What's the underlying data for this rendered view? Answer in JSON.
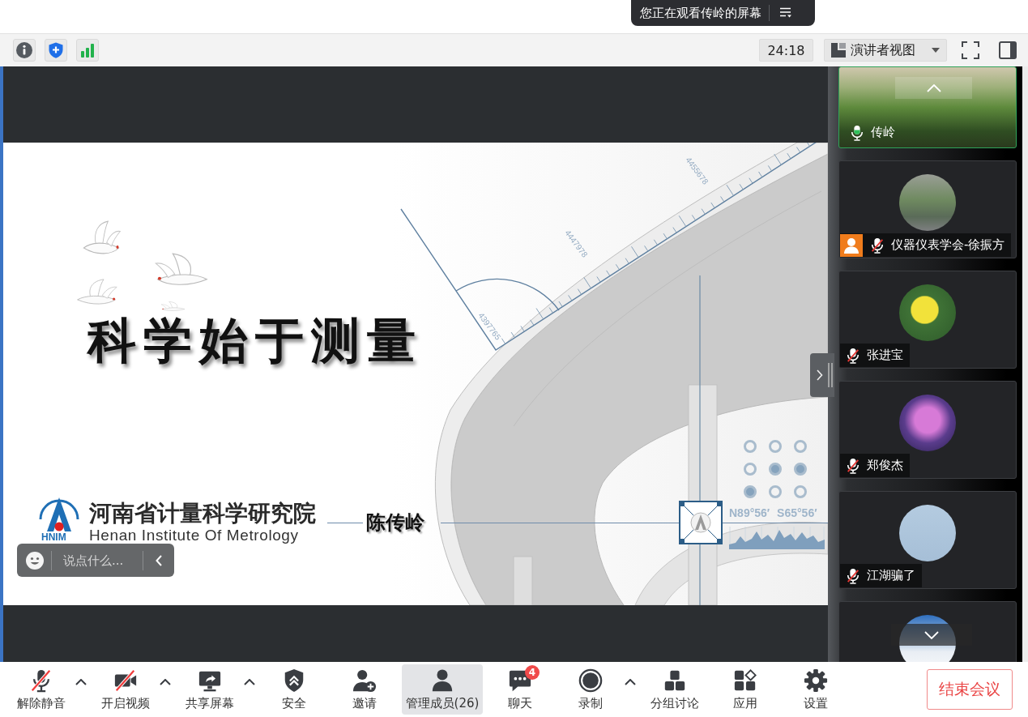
{
  "banner": {
    "text": "您正在观看传岭的屏幕"
  },
  "top_bar": {
    "timer": "24:18",
    "view_menu": "演讲者视图"
  },
  "slide": {
    "ruler_labels": [
      "4455678",
      "4447978",
      "4397765"
    ],
    "title": "科学始于测量",
    "logo_text": "HNIM",
    "org_name": "河南省计量科学研究院",
    "org_name_en": "Henan Institute Of Metrology",
    "presenter": "陈传岭",
    "coordinates": "N89°56′ S65°56′"
  },
  "chat_box": {
    "placeholder": "说点什么..."
  },
  "participants": [
    {
      "kind": "video",
      "name": "传岭",
      "muted": false,
      "person_badge": false,
      "active": true
    },
    {
      "kind": "avatar",
      "name": "仪器仪表学会-徐振方",
      "muted": true,
      "person_badge": true,
      "active": false
    },
    {
      "kind": "avatar",
      "name": "张进宝",
      "muted": true,
      "person_badge": false,
      "active": false
    },
    {
      "kind": "avatar",
      "name": "郑俊杰",
      "muted": true,
      "person_badge": false,
      "active": false
    },
    {
      "kind": "avatar",
      "name": "江湖骗了",
      "muted": true,
      "person_badge": false,
      "active": false
    },
    {
      "kind": "avatar",
      "active": false
    }
  ],
  "toolbar": [
    {
      "kind": "mic",
      "label": "解除静音",
      "off": true,
      "menu": true,
      "selected": false
    },
    {
      "kind": "video",
      "label": "开启视频",
      "off": true,
      "menu": true,
      "selected": false
    },
    {
      "kind": "share",
      "label": "共享屏幕",
      "off": false,
      "menu": true,
      "selected": false
    },
    {
      "kind": "security",
      "label": "安全",
      "off": false,
      "menu": false,
      "selected": false
    },
    {
      "kind": "invite",
      "label": "邀请",
      "off": false,
      "menu": false,
      "selected": false
    },
    {
      "kind": "participants",
      "label": "管理成员(26)",
      "off": false,
      "menu": false,
      "selected": true
    },
    {
      "kind": "chat",
      "label": "聊天",
      "badge": "4",
      "off": false,
      "menu": false,
      "selected": false
    },
    {
      "kind": "record",
      "label": "录制",
      "off": false,
      "menu": true,
      "selected": false
    },
    {
      "kind": "breakout",
      "label": "分组讨论",
      "off": false,
      "menu": false,
      "selected": false
    },
    {
      "kind": "apps",
      "label": "应用",
      "off": false,
      "menu": false,
      "selected": false
    },
    {
      "kind": "settings",
      "label": "设置",
      "off": false,
      "menu": false,
      "selected": false
    }
  ],
  "end_button": "结束会议"
}
